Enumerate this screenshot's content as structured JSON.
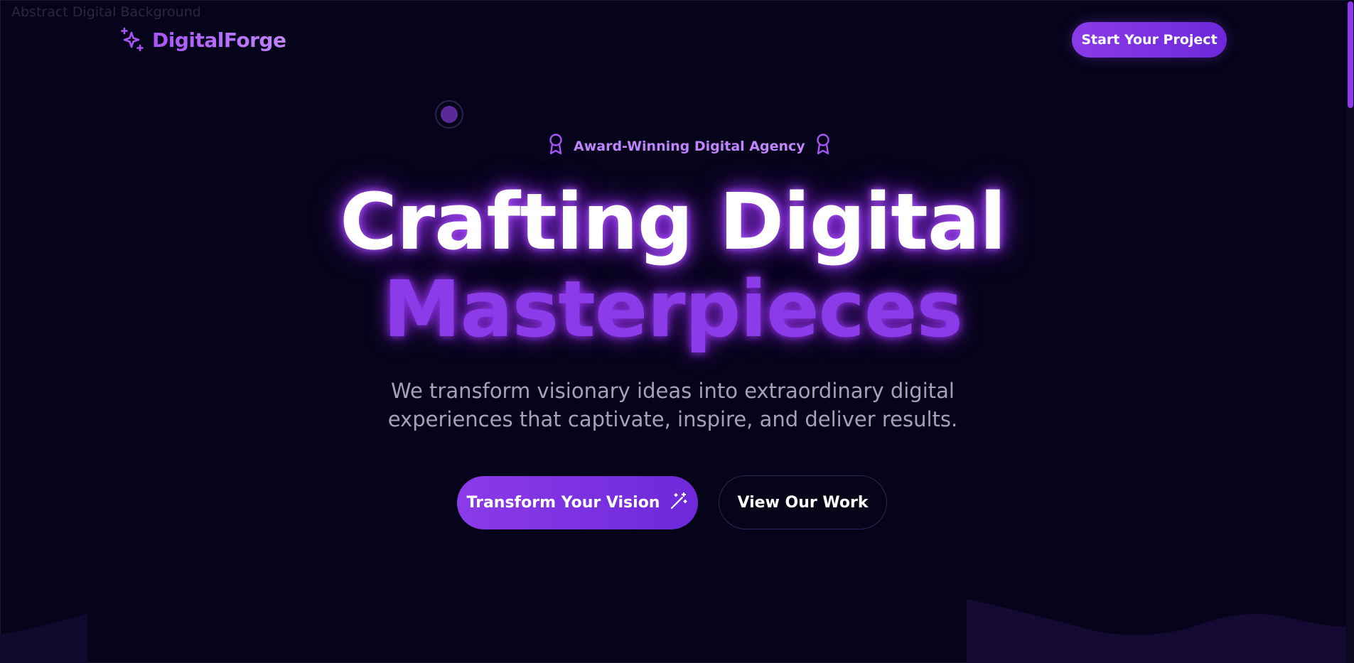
{
  "background": {
    "alt_text": "Abstract Digital Background"
  },
  "header": {
    "brand_name": "DigitalForge",
    "brand_icon": "sparkles-icon",
    "cta_label": "Start Your Project"
  },
  "hero": {
    "badge_text": "Award-Winning Digital Agency",
    "badge_icon": "award-ribbon-icon",
    "headline_line1": "Crafting Digital",
    "headline_line2": "Masterpieces",
    "subtext": "We transform visionary ideas into extraordinary digital experiences that captivate, inspire, and deliver results.",
    "primary_cta": "Transform Your Vision",
    "primary_cta_icon": "magic-wand-icon",
    "secondary_cta": "View Our Work"
  },
  "colors": {
    "background": "#06041a",
    "accent": "#8b3be8",
    "accent_light": "#c084fc",
    "text_muted": "#a3a3b3"
  }
}
